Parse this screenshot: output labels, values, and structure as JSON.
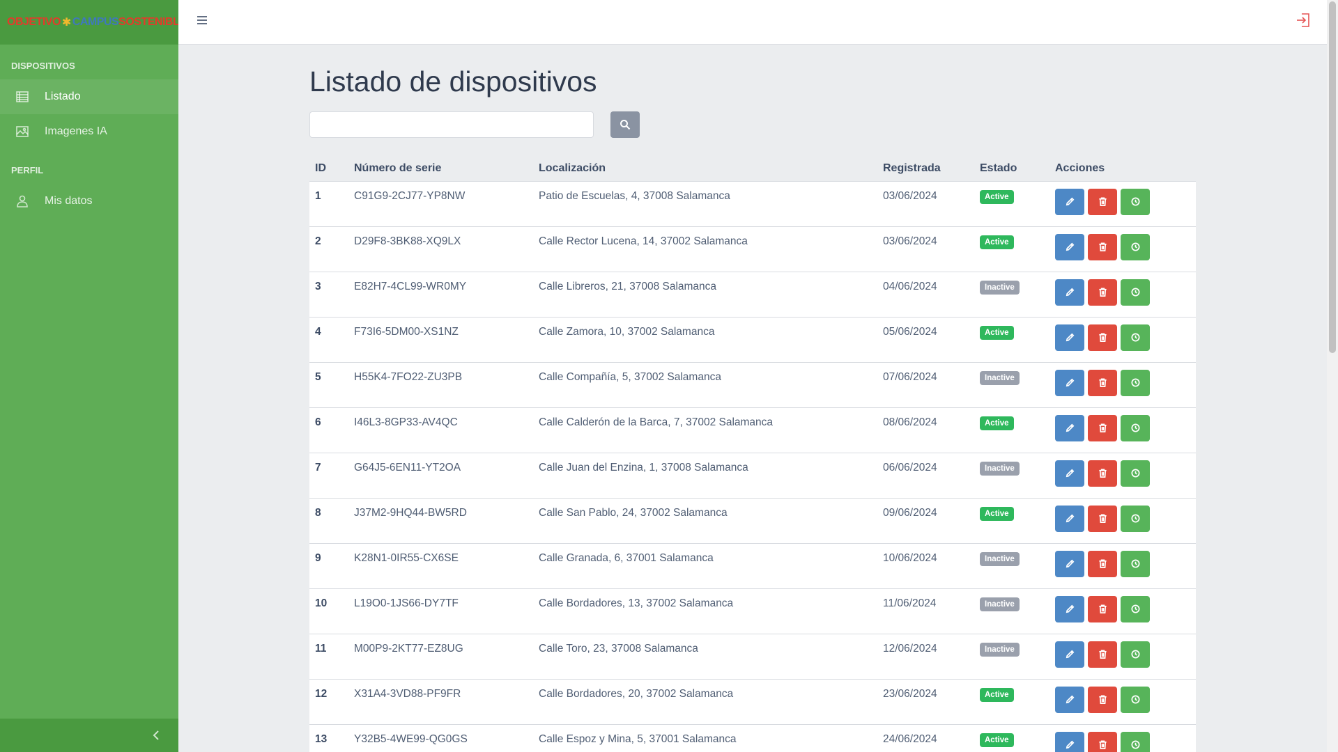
{
  "brand": {
    "part1": "OBJETIVO",
    "sep": "✱",
    "part2": "CAMPUS",
    "part3": "SOSTENIBLES"
  },
  "sidebar": {
    "sections": [
      {
        "title": "DISPOSITIVOS",
        "items": [
          {
            "label": "Listado",
            "icon": "table-list-icon",
            "active": true
          },
          {
            "label": "Imagenes IA",
            "icon": "image-icon",
            "active": false
          }
        ]
      },
      {
        "title": "PERFIL",
        "items": [
          {
            "label": "Mis datos",
            "icon": "user-icon",
            "active": false
          }
        ]
      }
    ]
  },
  "page": {
    "title": "Listado de dispositivos",
    "search_value": ""
  },
  "table": {
    "headers": [
      "ID",
      "Número de serie",
      "Localización",
      "Registrada",
      "Estado",
      "Acciones"
    ],
    "rows": [
      {
        "id": "1",
        "serial": "C91G9-2CJ77-YP8NW",
        "location": "Patio de Escuelas, 4, 37008 Salamanca",
        "registered": "03/06/2024",
        "status": "Active"
      },
      {
        "id": "2",
        "serial": "D29F8-3BK88-XQ9LX",
        "location": "Calle Rector Lucena, 14, 37002 Salamanca",
        "registered": "03/06/2024",
        "status": "Active"
      },
      {
        "id": "3",
        "serial": "E82H7-4CL99-WR0MY",
        "location": "Calle Libreros, 21, 37008 Salamanca",
        "registered": "04/06/2024",
        "status": "Inactive"
      },
      {
        "id": "4",
        "serial": "F73I6-5DM00-XS1NZ",
        "location": "Calle Zamora, 10, 37002 Salamanca",
        "registered": "05/06/2024",
        "status": "Active"
      },
      {
        "id": "5",
        "serial": "H55K4-7FO22-ZU3PB",
        "location": "Calle Compañía, 5, 37002 Salamanca",
        "registered": "07/06/2024",
        "status": "Inactive"
      },
      {
        "id": "6",
        "serial": "I46L3-8GP33-AV4QC",
        "location": "Calle Calderón de la Barca, 7, 37002 Salamanca",
        "registered": "08/06/2024",
        "status": "Active"
      },
      {
        "id": "7",
        "serial": "G64J5-6EN11-YT2OA",
        "location": "Calle Juan del Enzina, 1, 37008 Salamanca",
        "registered": "06/06/2024",
        "status": "Inactive"
      },
      {
        "id": "8",
        "serial": "J37M2-9HQ44-BW5RD",
        "location": "Calle San Pablo, 24, 37002 Salamanca",
        "registered": "09/06/2024",
        "status": "Active"
      },
      {
        "id": "9",
        "serial": "K28N1-0IR55-CX6SE",
        "location": "Calle Granada, 6, 37001 Salamanca",
        "registered": "10/06/2024",
        "status": "Inactive"
      },
      {
        "id": "10",
        "serial": "L19O0-1JS66-DY7TF",
        "location": "Calle Bordadores, 13, 37002 Salamanca",
        "registered": "11/06/2024",
        "status": "Inactive"
      },
      {
        "id": "11",
        "serial": "M00P9-2KT77-EZ8UG",
        "location": "Calle Toro, 23, 37008 Salamanca",
        "registered": "12/06/2024",
        "status": "Inactive"
      },
      {
        "id": "12",
        "serial": "X31A4-3VD88-PF9FR",
        "location": "Calle Bordadores, 20, 37002 Salamanca",
        "registered": "23/06/2024",
        "status": "Active"
      },
      {
        "id": "13",
        "serial": "Y32B5-4WE99-QG0GS",
        "location": "Calle Espoz y Mina, 5, 37001 Salamanca",
        "registered": "24/06/2024",
        "status": "Active"
      }
    ]
  },
  "colors": {
    "sidebar": "#5fad56",
    "active": "#2eb85c",
    "inactive": "#9aa0ac",
    "edit": "#4d88c6",
    "delete": "#e04a3c",
    "view": "#57b45a",
    "logout": "#e55353"
  }
}
